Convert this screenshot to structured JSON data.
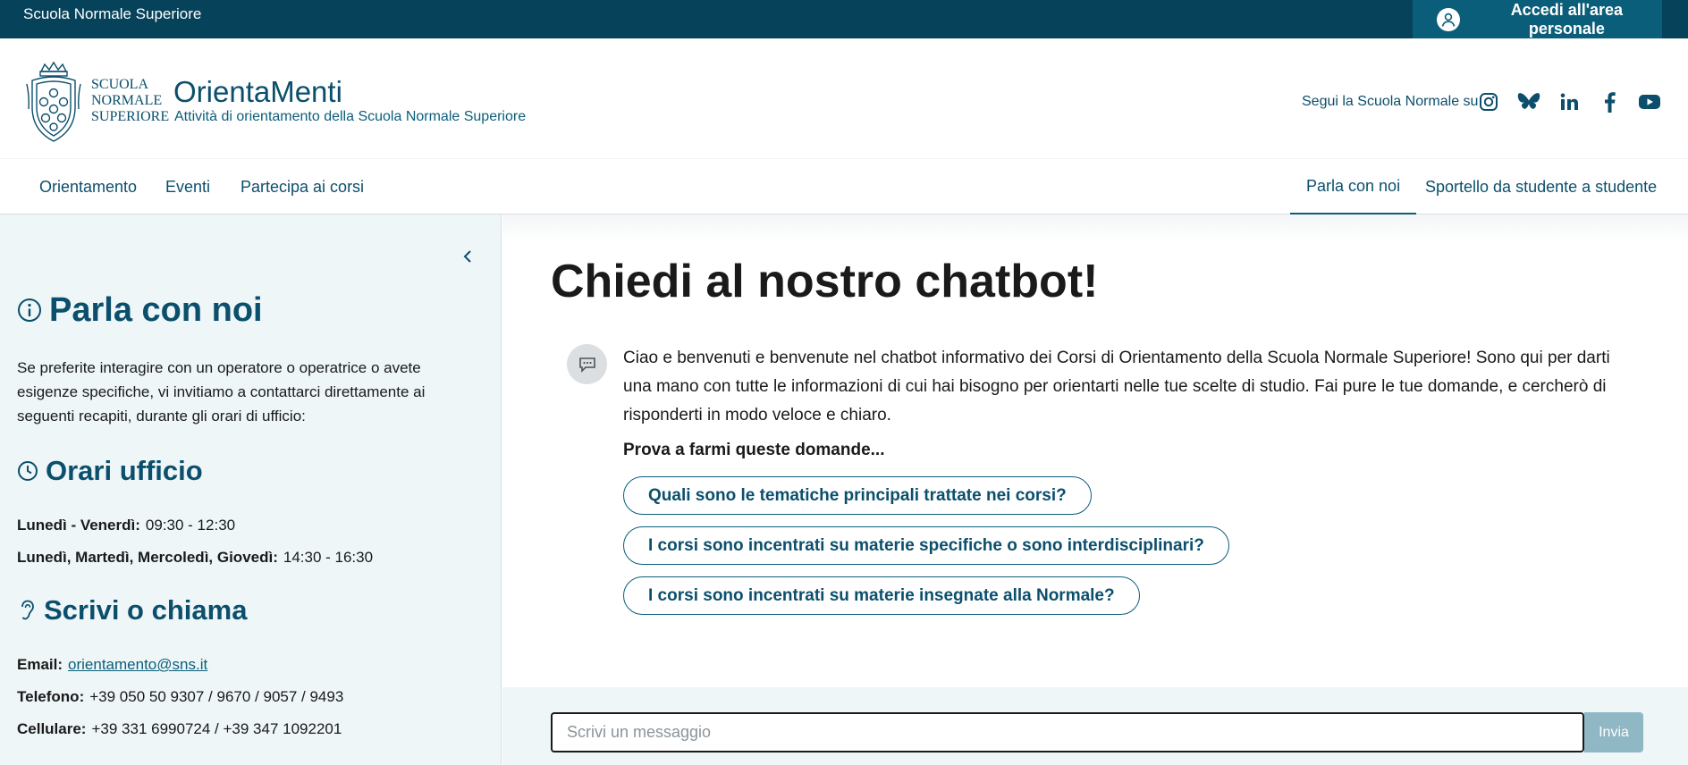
{
  "topbar": {
    "brand": "Scuola Normale Superiore",
    "login_label": "Accedi all'area personale"
  },
  "header": {
    "seal_lines": [
      "SCUOLA",
      "NORMALE",
      "SUPERIORE"
    ],
    "title": "OrientaMenti",
    "subtitle": "Attività di orientamento della Scuola Normale Superiore",
    "social_label": "Segui la Scuola Normale su",
    "social_icons": [
      "instagram-icon",
      "bluesky-icon",
      "linkedin-icon",
      "facebook-icon",
      "youtube-icon"
    ]
  },
  "nav": {
    "left": [
      "Orientamento",
      "Eventi",
      "Partecipa ai corsi"
    ],
    "right": [
      "Parla con noi",
      "Sportello da studente a studente"
    ],
    "active": "Parla con noi"
  },
  "sidebar": {
    "title": "Parla con noi",
    "intro": "Se preferite interagire con un operatore o operatrice o avete esigenze specifiche, vi invitiamo a contattarci direttamente ai seguenti recapiti, durante gli orari di ufficio:",
    "hours_title": "Orari ufficio",
    "hours": [
      {
        "label": "Lunedì - Venerdì:",
        "value": "09:30 - 12:30"
      },
      {
        "label": "Lunedì, Martedì, Mercoledì, Giovedì:",
        "value": "14:30 - 16:30"
      }
    ],
    "contact_title": "Scrivi o chiama",
    "contacts": [
      {
        "label": "Email:",
        "value": "orientamento@sns.it"
      },
      {
        "label": "Telefono:",
        "value": "+39 050 50 9307 / 9670 / 9057 / 9493"
      },
      {
        "label": "Cellulare:",
        "value": "+39 331 6990724 / +39 347 1092201"
      }
    ]
  },
  "chat": {
    "title": "Chiedi al nostro chatbot!",
    "bot_message": "Ciao e benvenuti e benvenute nel chatbot informativo dei Corsi di Orientamento della Scuola Normale Superiore! Sono qui per darti una mano con tutte le informazioni di cui hai bisogno per orientarti nelle tue scelte di studio. Fai pure le tue domande, e cercherò di risponderti in modo veloce e chiaro.",
    "prompt": "Prova a farmi queste domande...",
    "suggestions": [
      "Quali sono le tematiche principali trattate nei corsi?",
      "I corsi sono incentrati su materie specifiche o sono interdisciplinari?",
      "I corsi sono incentrati su materie insegnate alla Normale?"
    ],
    "input_placeholder": "Scrivi un messaggio",
    "input_value": "",
    "send_label": "Invia"
  },
  "colors": {
    "brand_dark": "#06435a",
    "brand": "#0b5e7a",
    "sidebar_bg": "#eef6f8",
    "send_disabled": "#8fb7c4"
  }
}
